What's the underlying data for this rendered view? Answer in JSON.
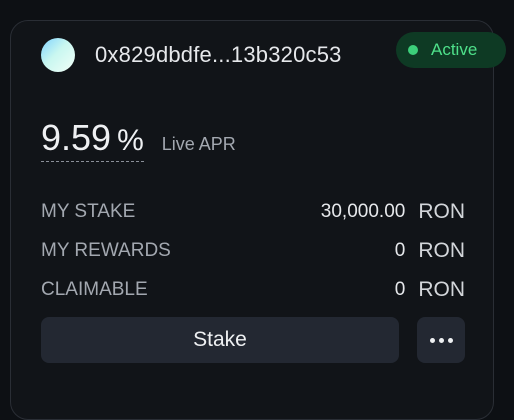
{
  "validator": {
    "address": "0x829dbdfe...13b320c53",
    "status": "Active",
    "status_color": "#4ee08a",
    "avatar_icon": "gradient-avatar"
  },
  "apr": {
    "value": "9.59",
    "unit": "%",
    "label": "Live APR"
  },
  "stats": [
    {
      "label": "MY STAKE",
      "value": "30,000.00",
      "unit": "RON"
    },
    {
      "label": "MY REWARDS",
      "value": "0",
      "unit": "RON"
    },
    {
      "label": "CLAIMABLE",
      "value": "0",
      "unit": "RON"
    }
  ],
  "actions": {
    "stake_label": "Stake",
    "more_icon": "more-horizontal-icon"
  }
}
